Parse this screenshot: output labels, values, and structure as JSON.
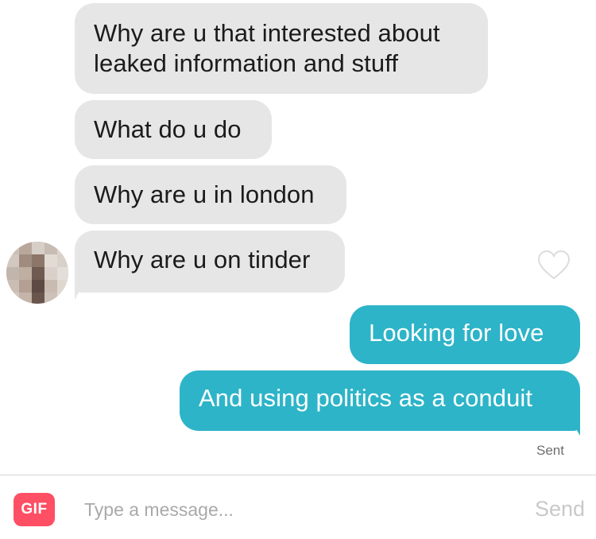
{
  "conversation": {
    "messages": [
      {
        "direction": "incoming",
        "text": "Why are u that interested about leaked information and stuff"
      },
      {
        "direction": "incoming",
        "text": "What do u do"
      },
      {
        "direction": "incoming",
        "text": "Why are u in london"
      },
      {
        "direction": "incoming",
        "text": "Why are u on tinder"
      },
      {
        "direction": "outgoing",
        "text": "Looking for love"
      },
      {
        "direction": "outgoing",
        "text": "And using politics as a conduit"
      }
    ],
    "status": "Sent",
    "icons": {
      "avatar": "pixelated-avatar",
      "like": "heart-outline-icon"
    }
  },
  "composer": {
    "gif_label": "GIF",
    "placeholder": "Type a message...",
    "value": "",
    "send_label": "Send"
  },
  "colors": {
    "incoming_bubble": "#e6e6e6",
    "outgoing_bubble": "#2db4c8",
    "gif_button": "#fe4f64",
    "send_disabled": "#c9c9c9"
  }
}
